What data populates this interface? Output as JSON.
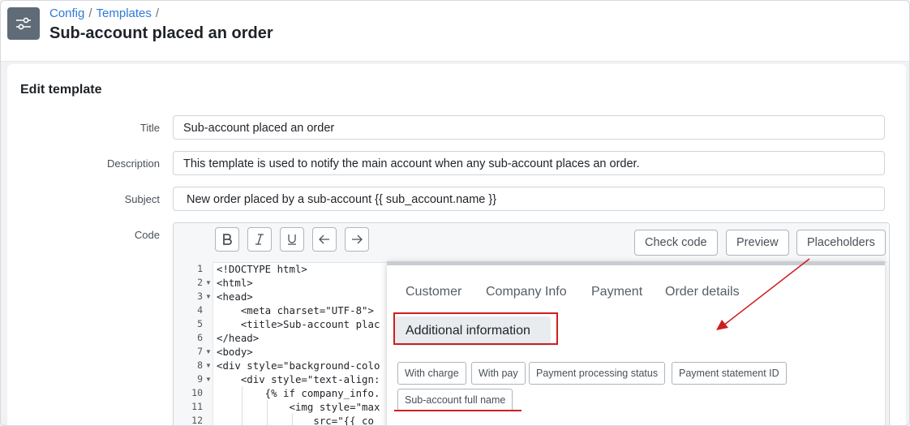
{
  "header": {
    "breadcrumb": [
      "Config",
      "Templates"
    ],
    "title": "Sub-account placed an order",
    "icon": "sliders-icon"
  },
  "card": {
    "title": "Edit template",
    "fields": {
      "title": {
        "label": "Title",
        "value": "Sub-account placed an order"
      },
      "description": {
        "label": "Description",
        "value": "This template is used to notify the main account when any sub-account places an order."
      },
      "subject": {
        "label": "Subject",
        "value": "New order placed by a sub-account {{ sub_account.name }}"
      },
      "code": {
        "label": "Code"
      }
    }
  },
  "editor": {
    "format_buttons": [
      "bold-icon",
      "italic-icon",
      "underline-icon",
      "undo-arrow-icon",
      "redo-arrow-icon"
    ],
    "toolbar": {
      "check_code": "Check code",
      "preview": "Preview",
      "placeholders": "Placeholders"
    },
    "line_numbers": [
      "1",
      "2",
      "3",
      "4",
      "5",
      "6",
      "7",
      "8",
      "9",
      "10",
      "11",
      "12"
    ],
    "lines": [
      "<!DOCTYPE html>",
      "<html>",
      "<head>",
      "    <meta charset=\"UTF-8\">",
      "    <title>Sub-account plac",
      "</head>",
      "<body>",
      "<div style=\"background-colo",
      "    <div style=\"text-align:",
      "        {% if company_info.",
      "            <img style=\"max",
      "                src=\"{{ co"
    ]
  },
  "popup": {
    "tabs": [
      "Customer",
      "Company Info",
      "Payment",
      "Order details"
    ],
    "active_tab": "Additional information",
    "chips": [
      "With charge",
      "With pay",
      "Payment processing status",
      "Payment statement ID",
      "Sub-account full name"
    ]
  },
  "colors": {
    "accent_link": "#2f79d8",
    "annotation_red": "#cc1f1f",
    "header_icon_bg": "#5f6b77"
  }
}
